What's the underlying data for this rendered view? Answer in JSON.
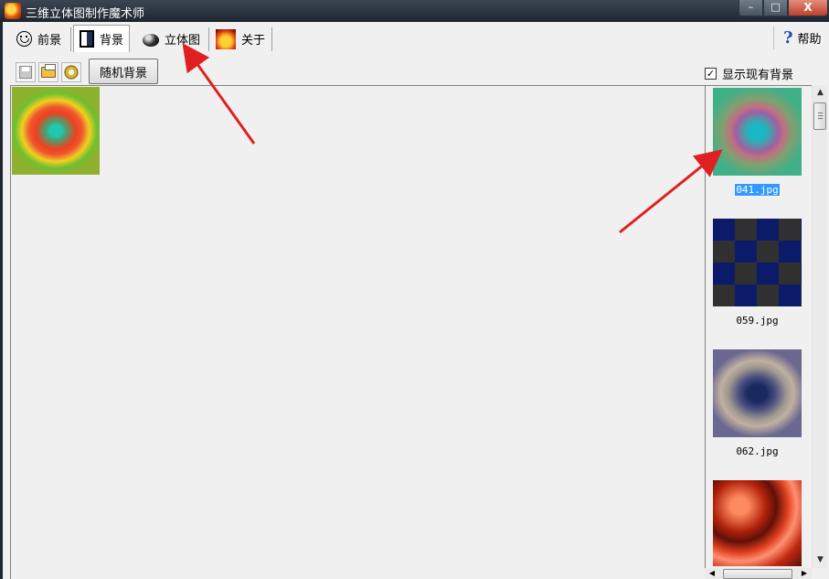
{
  "window": {
    "title": "三维立体图制作魔术师",
    "controls": {
      "minimize": "–",
      "maximize": "□",
      "close": "X"
    }
  },
  "tabs": [
    {
      "label": "前景",
      "icon": "smiley-face-icon"
    },
    {
      "label": "背景",
      "icon": "background-icon",
      "active": true
    },
    {
      "label": "立体图",
      "icon": "stereogram-ball-icon"
    },
    {
      "label": "关于",
      "icon": "about-icon"
    }
  ],
  "help": {
    "label": "帮助",
    "icon": "question-mark-icon"
  },
  "toolbar": {
    "icons": [
      "save-icon",
      "open-folder-icon",
      "settings-gear-icon"
    ],
    "random_button": "随机背景"
  },
  "show_existing_bg": {
    "label": "显示现有背景",
    "checked": true,
    "mark": "✓"
  },
  "thumbnails": [
    {
      "filename": "041.jpg",
      "selected": true
    },
    {
      "filename": "059.jpg",
      "selected": false
    },
    {
      "filename": "062.jpg",
      "selected": false
    },
    {
      "filename": "",
      "selected": false
    }
  ],
  "scrollbar": {
    "up": "▲",
    "down": "▼",
    "left": "◀",
    "right": "▶",
    "grip": "|||"
  },
  "annotation_color": "#e02020"
}
